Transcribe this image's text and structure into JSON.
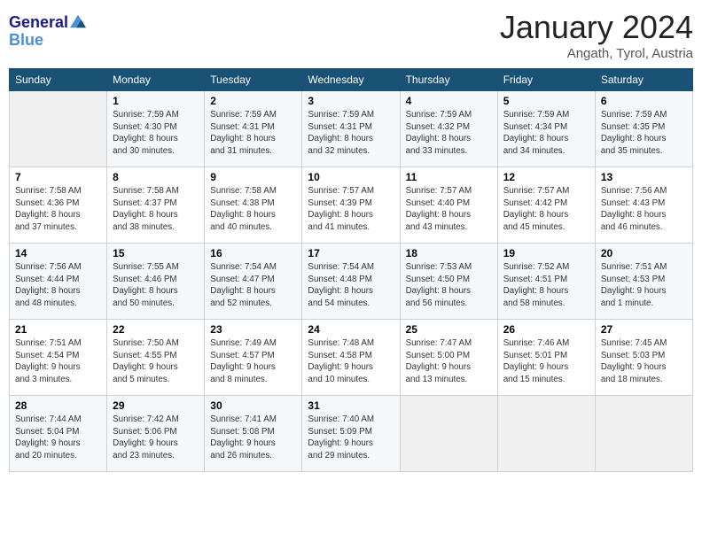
{
  "logo": {
    "line1": "General",
    "line2": "Blue"
  },
  "title": "January 2024",
  "location": "Angath, Tyrol, Austria",
  "weekdays": [
    "Sunday",
    "Monday",
    "Tuesday",
    "Wednesday",
    "Thursday",
    "Friday",
    "Saturday"
  ],
  "weeks": [
    [
      {
        "day": "",
        "sunrise": "",
        "sunset": "",
        "daylight": ""
      },
      {
        "day": "1",
        "sunrise": "Sunrise: 7:59 AM",
        "sunset": "Sunset: 4:30 PM",
        "daylight": "Daylight: 8 hours and 30 minutes."
      },
      {
        "day": "2",
        "sunrise": "Sunrise: 7:59 AM",
        "sunset": "Sunset: 4:31 PM",
        "daylight": "Daylight: 8 hours and 31 minutes."
      },
      {
        "day": "3",
        "sunrise": "Sunrise: 7:59 AM",
        "sunset": "Sunset: 4:31 PM",
        "daylight": "Daylight: 8 hours and 32 minutes."
      },
      {
        "day": "4",
        "sunrise": "Sunrise: 7:59 AM",
        "sunset": "Sunset: 4:32 PM",
        "daylight": "Daylight: 8 hours and 33 minutes."
      },
      {
        "day": "5",
        "sunrise": "Sunrise: 7:59 AM",
        "sunset": "Sunset: 4:34 PM",
        "daylight": "Daylight: 8 hours and 34 minutes."
      },
      {
        "day": "6",
        "sunrise": "Sunrise: 7:59 AM",
        "sunset": "Sunset: 4:35 PM",
        "daylight": "Daylight: 8 hours and 35 minutes."
      }
    ],
    [
      {
        "day": "7",
        "sunrise": "Sunrise: 7:58 AM",
        "sunset": "Sunset: 4:36 PM",
        "daylight": "Daylight: 8 hours and 37 minutes."
      },
      {
        "day": "8",
        "sunrise": "Sunrise: 7:58 AM",
        "sunset": "Sunset: 4:37 PM",
        "daylight": "Daylight: 8 hours and 38 minutes."
      },
      {
        "day": "9",
        "sunrise": "Sunrise: 7:58 AM",
        "sunset": "Sunset: 4:38 PM",
        "daylight": "Daylight: 8 hours and 40 minutes."
      },
      {
        "day": "10",
        "sunrise": "Sunrise: 7:57 AM",
        "sunset": "Sunset: 4:39 PM",
        "daylight": "Daylight: 8 hours and 41 minutes."
      },
      {
        "day": "11",
        "sunrise": "Sunrise: 7:57 AM",
        "sunset": "Sunset: 4:40 PM",
        "daylight": "Daylight: 8 hours and 43 minutes."
      },
      {
        "day": "12",
        "sunrise": "Sunrise: 7:57 AM",
        "sunset": "Sunset: 4:42 PM",
        "daylight": "Daylight: 8 hours and 45 minutes."
      },
      {
        "day": "13",
        "sunrise": "Sunrise: 7:56 AM",
        "sunset": "Sunset: 4:43 PM",
        "daylight": "Daylight: 8 hours and 46 minutes."
      }
    ],
    [
      {
        "day": "14",
        "sunrise": "Sunrise: 7:56 AM",
        "sunset": "Sunset: 4:44 PM",
        "daylight": "Daylight: 8 hours and 48 minutes."
      },
      {
        "day": "15",
        "sunrise": "Sunrise: 7:55 AM",
        "sunset": "Sunset: 4:46 PM",
        "daylight": "Daylight: 8 hours and 50 minutes."
      },
      {
        "day": "16",
        "sunrise": "Sunrise: 7:54 AM",
        "sunset": "Sunset: 4:47 PM",
        "daylight": "Daylight: 8 hours and 52 minutes."
      },
      {
        "day": "17",
        "sunrise": "Sunrise: 7:54 AM",
        "sunset": "Sunset: 4:48 PM",
        "daylight": "Daylight: 8 hours and 54 minutes."
      },
      {
        "day": "18",
        "sunrise": "Sunrise: 7:53 AM",
        "sunset": "Sunset: 4:50 PM",
        "daylight": "Daylight: 8 hours and 56 minutes."
      },
      {
        "day": "19",
        "sunrise": "Sunrise: 7:52 AM",
        "sunset": "Sunset: 4:51 PM",
        "daylight": "Daylight: 8 hours and 58 minutes."
      },
      {
        "day": "20",
        "sunrise": "Sunrise: 7:51 AM",
        "sunset": "Sunset: 4:53 PM",
        "daylight": "Daylight: 9 hours and 1 minute."
      }
    ],
    [
      {
        "day": "21",
        "sunrise": "Sunrise: 7:51 AM",
        "sunset": "Sunset: 4:54 PM",
        "daylight": "Daylight: 9 hours and 3 minutes."
      },
      {
        "day": "22",
        "sunrise": "Sunrise: 7:50 AM",
        "sunset": "Sunset: 4:55 PM",
        "daylight": "Daylight: 9 hours and 5 minutes."
      },
      {
        "day": "23",
        "sunrise": "Sunrise: 7:49 AM",
        "sunset": "Sunset: 4:57 PM",
        "daylight": "Daylight: 9 hours and 8 minutes."
      },
      {
        "day": "24",
        "sunrise": "Sunrise: 7:48 AM",
        "sunset": "Sunset: 4:58 PM",
        "daylight": "Daylight: 9 hours and 10 minutes."
      },
      {
        "day": "25",
        "sunrise": "Sunrise: 7:47 AM",
        "sunset": "Sunset: 5:00 PM",
        "daylight": "Daylight: 9 hours and 13 minutes."
      },
      {
        "day": "26",
        "sunrise": "Sunrise: 7:46 AM",
        "sunset": "Sunset: 5:01 PM",
        "daylight": "Daylight: 9 hours and 15 minutes."
      },
      {
        "day": "27",
        "sunrise": "Sunrise: 7:45 AM",
        "sunset": "Sunset: 5:03 PM",
        "daylight": "Daylight: 9 hours and 18 minutes."
      }
    ],
    [
      {
        "day": "28",
        "sunrise": "Sunrise: 7:44 AM",
        "sunset": "Sunset: 5:04 PM",
        "daylight": "Daylight: 9 hours and 20 minutes."
      },
      {
        "day": "29",
        "sunrise": "Sunrise: 7:42 AM",
        "sunset": "Sunset: 5:06 PM",
        "daylight": "Daylight: 9 hours and 23 minutes."
      },
      {
        "day": "30",
        "sunrise": "Sunrise: 7:41 AM",
        "sunset": "Sunset: 5:08 PM",
        "daylight": "Daylight: 9 hours and 26 minutes."
      },
      {
        "day": "31",
        "sunrise": "Sunrise: 7:40 AM",
        "sunset": "Sunset: 5:09 PM",
        "daylight": "Daylight: 9 hours and 29 minutes."
      },
      {
        "day": "",
        "sunrise": "",
        "sunset": "",
        "daylight": ""
      },
      {
        "day": "",
        "sunrise": "",
        "sunset": "",
        "daylight": ""
      },
      {
        "day": "",
        "sunrise": "",
        "sunset": "",
        "daylight": ""
      }
    ]
  ]
}
